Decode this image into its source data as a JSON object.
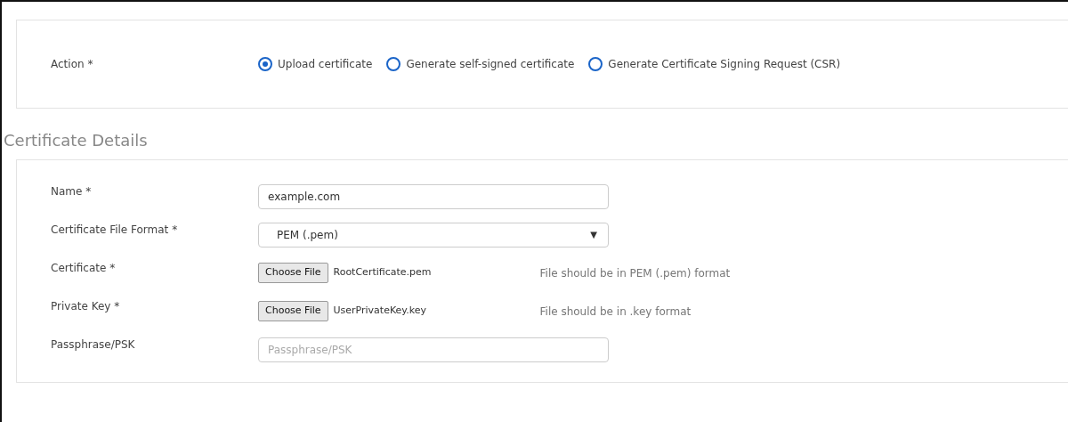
{
  "action": {
    "label": "Action *",
    "options": [
      {
        "label": "Upload certificate",
        "selected": true
      },
      {
        "label": "Generate self-signed certificate",
        "selected": false
      },
      {
        "label": "Generate Certificate Signing Request (CSR)",
        "selected": false
      }
    ]
  },
  "section_title": "Certificate Details",
  "fields": [
    {
      "kind": "text",
      "label": "Name *",
      "value": "example.com"
    },
    {
      "kind": "select",
      "label": "Certificate File Format *",
      "value": "PEM (.pem)",
      "caret": "▼"
    },
    {
      "kind": "file",
      "label": "Certificate *",
      "button": "Choose File",
      "filename": "RootCertificate.pem",
      "hint": "File should be in PEM (.pem) format"
    },
    {
      "kind": "file",
      "label": "Private Key *",
      "button": "Choose File",
      "filename": "UserPrivateKey.key",
      "hint": "File should be in .key format"
    },
    {
      "kind": "text",
      "label": "Passphrase/PSK",
      "placeholder": "Passphrase/PSK"
    }
  ]
}
